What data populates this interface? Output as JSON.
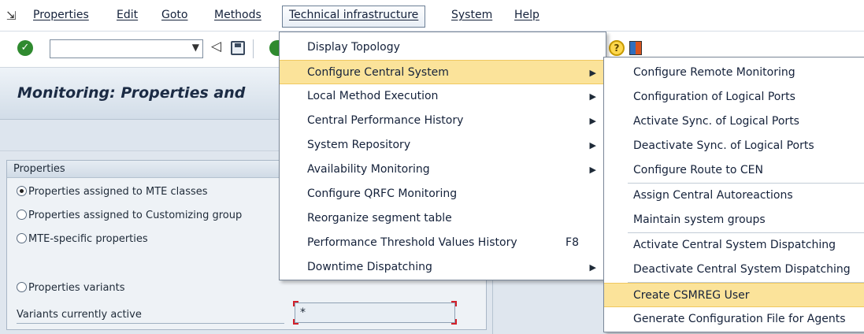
{
  "menubar": {
    "items": [
      "Properties",
      "Edit",
      "Goto",
      "Methods",
      "Technical infrastructure",
      "System",
      "Help"
    ]
  },
  "toolbar": {
    "command_field_value": ""
  },
  "title": "Monitoring: Properties and",
  "group": {
    "heading": "Properties",
    "radios": [
      {
        "label": "Properties assigned to MTE classes",
        "selected": true
      },
      {
        "label": "Properties assigned to Customizing group",
        "selected": false
      },
      {
        "label": "MTE-specific properties",
        "selected": false
      },
      {
        "label": "Properties variants",
        "selected": false
      }
    ],
    "variants_label": "Variants currently active",
    "variants_value": "*"
  },
  "menu_technical": {
    "items": [
      {
        "label": "Display Topology",
        "submenu": false,
        "shortcut": ""
      },
      {
        "label": "Configure Central System",
        "submenu": true,
        "shortcut": "",
        "highlighted": true
      },
      {
        "label": "Local Method Execution",
        "submenu": true,
        "shortcut": ""
      },
      {
        "label": "Central Performance History",
        "submenu": true,
        "shortcut": ""
      },
      {
        "label": "System Repository",
        "submenu": true,
        "shortcut": ""
      },
      {
        "label": "Availability Monitoring",
        "submenu": true,
        "shortcut": ""
      },
      {
        "label": "Configure QRFC Monitoring",
        "submenu": false,
        "shortcut": ""
      },
      {
        "label": "Reorganize segment table",
        "submenu": false,
        "shortcut": ""
      },
      {
        "label": "Performance Threshold Values History",
        "submenu": false,
        "shortcut": "F8"
      },
      {
        "label": "Downtime Dispatching",
        "submenu": true,
        "shortcut": ""
      }
    ]
  },
  "menu_central": {
    "items": [
      "Configure Remote Monitoring",
      "Configuration of Logical Ports",
      "Activate Sync. of Logical Ports",
      "Deactivate Sync. of Logical Ports",
      "Configure Route to CEN",
      "Assign Central Autoreactions",
      "Maintain system groups",
      "Activate Central System Dispatching",
      "Deactivate Central System Dispatching",
      "Create CSMREG User",
      "Generate Configuration File for Agents"
    ]
  },
  "colors": {
    "highlight": "#fbe39a",
    "background": "#dfe6ee",
    "required_marker": "#d3202a"
  }
}
